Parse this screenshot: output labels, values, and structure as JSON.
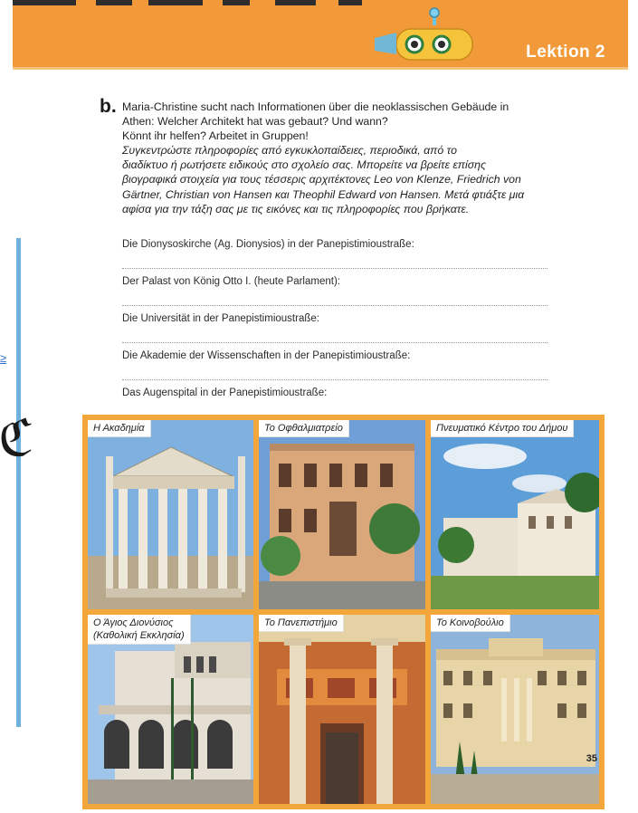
{
  "header": {
    "lesson_label": "Lektion 2"
  },
  "exercise": {
    "letter": "b.",
    "german_lines": [
      "Maria-Christine sucht nach Informationen über die neoklassischen Gebäude in",
      "Athen: Welcher Architekt hat was gebaut? Und wann?",
      "Könnt ihr helfen? Arbeitet in Gruppen!"
    ],
    "greek_lines": [
      "Συγκεντρώστε πληροφορίες από εγκυκλοπαίδειες, περιοδικά, από το",
      "διαδίκτυο ή ρωτήσετε ειδικούς στο σχολείο σας. Μπορείτε να βρείτε επίσης",
      "βιογραφικά στοιχεία για τους τέσσερις αρχιτέκτονες Leo von Klenze, Friedrich von",
      "Gärtner, Christian von Hansen και Theophil Edward von Hansen. Μετά φτιάξτε μια",
      "αφίσα για την τάξη σας με τις εικόνες και τις πληροφορίες που βρήκατε."
    ]
  },
  "questions": [
    "Die Dionysoskirche (Ag. Dionysios) in der Panepistimioustraße:",
    "Der Palast von König Otto I. (heute Parlament):",
    "Die Universität in der Panepistimioustraße:",
    "Die Akademie der Wissenschaften in der Panepistimioustraße:",
    "Das Augenspital in der Panepistimioustraße:"
  ],
  "photos": [
    {
      "caption": "Η Ακαδημία"
    },
    {
      "caption": "Το Οφθαλμιατρείο"
    },
    {
      "caption": "Πνευματικό Κέντρο του Δήμου"
    },
    {
      "caption_line1": "Ο Άγιος Διονύσιος",
      "caption_line2": "(Καθολική Εκκλησία)"
    },
    {
      "caption": "Το Πανεπιστήμιο"
    },
    {
      "caption": "Το Κοινοβούλιο"
    }
  ],
  "page_number": "35",
  "side": {
    "link_char": "≥",
    "glyph": "ℭ"
  },
  "colors": {
    "header": "#f29a3a",
    "frame": "#f3a63a",
    "side_bar": "#6fb0dc"
  }
}
